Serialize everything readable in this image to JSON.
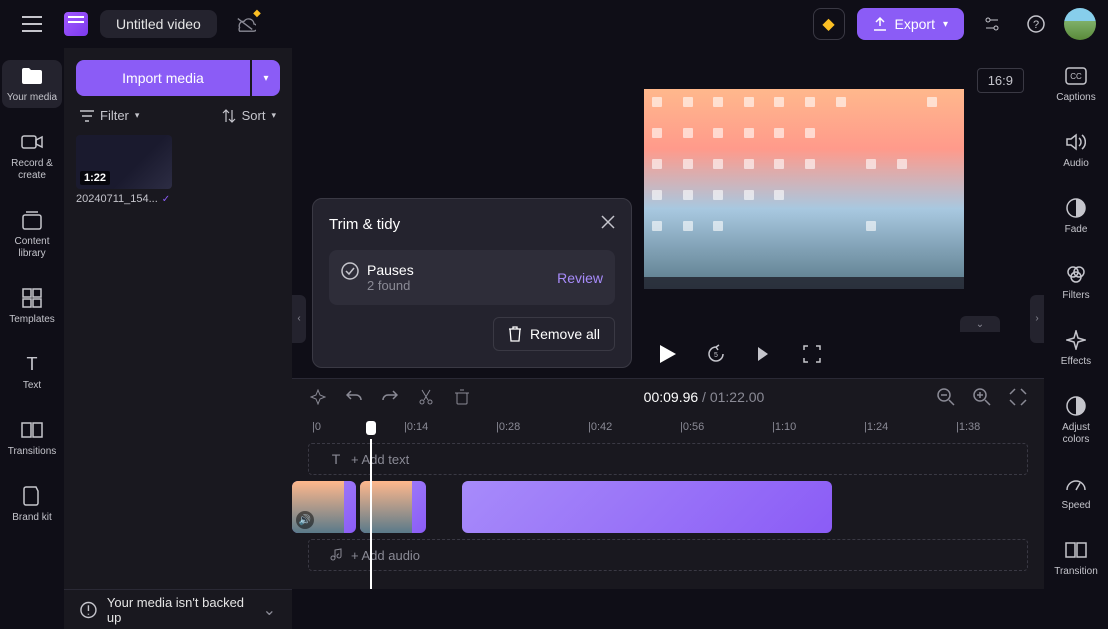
{
  "header": {
    "title": "Untitled video",
    "export_label": "Export"
  },
  "left_nav": [
    {
      "label": "Your media"
    },
    {
      "label": "Record & create"
    },
    {
      "label": "Content library"
    },
    {
      "label": "Templates"
    },
    {
      "label": "Text"
    },
    {
      "label": "Transitions"
    },
    {
      "label": "Brand kit"
    }
  ],
  "media_panel": {
    "import_label": "Import media",
    "filter_label": "Filter",
    "sort_label": "Sort",
    "items": [
      {
        "duration": "1:22",
        "name": "20240711_154..."
      }
    ]
  },
  "preview": {
    "aspect": "16:9"
  },
  "trim_popup": {
    "title": "Trim & tidy",
    "item_label": "Pauses",
    "item_sub": "2 found",
    "review": "Review",
    "remove": "Remove all"
  },
  "timeline": {
    "current": "00:09.96",
    "total": "01:22.00",
    "ruler": [
      "0",
      "0:14",
      "0:28",
      "0:42",
      "0:56",
      "1:10",
      "1:24",
      "1:38"
    ],
    "add_text": "+ Add text",
    "add_audio": "+ Add audio"
  },
  "right_nav": [
    {
      "label": "Captions"
    },
    {
      "label": "Audio"
    },
    {
      "label": "Fade"
    },
    {
      "label": "Filters"
    },
    {
      "label": "Effects"
    },
    {
      "label": "Adjust colors"
    },
    {
      "label": "Speed"
    },
    {
      "label": "Transition"
    }
  ],
  "footer": {
    "warning": "Your media isn't backed up"
  }
}
